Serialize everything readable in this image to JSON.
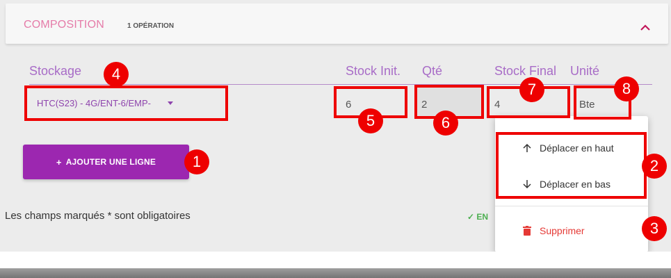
{
  "header": {
    "title": "COMPOSITION",
    "count": "1 OPÉRATION"
  },
  "columns": {
    "storage": "Stockage",
    "stock_init": "Stock Init.",
    "qty": "Qté",
    "stock_final": "Stock Final",
    "unit": "Unité"
  },
  "row": {
    "storage": "HTC(S23) - 4G/ENT-6/EMP-",
    "stock_init": "6",
    "qty": "2",
    "stock_final": "4",
    "unit": "Bte"
  },
  "add_button": {
    "plus": "+",
    "label": "AJOUTER UNE LIGNE"
  },
  "required_note": "Les champs marqués * sont obligatoires",
  "save_snippet": "✓ EN",
  "context_menu": {
    "move_up": "Déplacer en haut",
    "move_down": "Déplacer en bas",
    "delete": "Supprimer"
  },
  "annotations": {
    "badge_1": "1",
    "badge_2": "2",
    "badge_3": "3",
    "badge_4": "4",
    "badge_5": "5",
    "badge_6": "6",
    "badge_7": "7",
    "badge_8": "8"
  },
  "colors": {
    "accent": "#9c27b0",
    "title": "#e57ba8",
    "annotation": "#ee0000",
    "delete": "#e53935"
  }
}
